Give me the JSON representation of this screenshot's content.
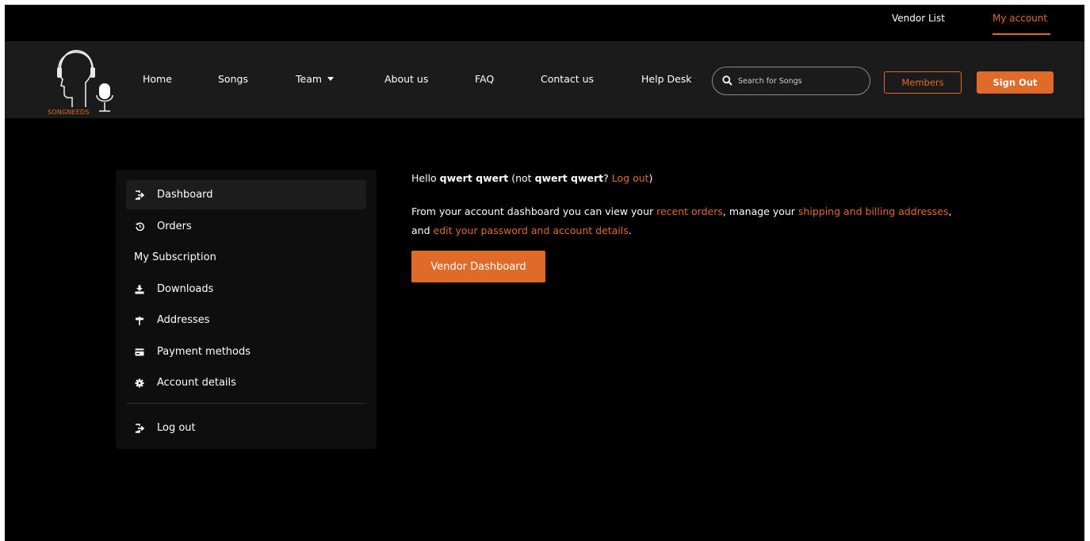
{
  "topbar": {
    "vendor_list": "Vendor List",
    "my_account": "My account"
  },
  "brand": {
    "logo_text": "SONGNEEDS"
  },
  "nav": {
    "home": "Home",
    "songs": "Songs",
    "team": "Team",
    "about": "About us",
    "faq": "FAQ",
    "contact": "Contact us",
    "help": "Help Desk"
  },
  "search": {
    "placeholder": "Search for Songs"
  },
  "buttons": {
    "members": "Members",
    "sign_out": "Sign Out",
    "vendor_dashboard": "Vendor Dashboard"
  },
  "sidebar": {
    "items": [
      {
        "label": "Dashboard",
        "icon": "sign-in-icon"
      },
      {
        "label": "Orders",
        "icon": "history-icon"
      },
      {
        "label": "My Subscription",
        "icon": ""
      },
      {
        "label": "Downloads",
        "icon": "download-icon"
      },
      {
        "label": "Addresses",
        "icon": "signpost-icon"
      },
      {
        "label": "Payment methods",
        "icon": "credit-card-icon"
      },
      {
        "label": "Account details",
        "icon": "gear-icon"
      },
      {
        "label": "Log out",
        "icon": "sign-out-icon"
      }
    ]
  },
  "main": {
    "hello_prefix": "Hello ",
    "username": "qwert qwert",
    "not_prefix": " (not ",
    "username2": "qwert qwert",
    "question": "? ",
    "logout_link": "Log out",
    "close_paren": ")",
    "desc_1": "From your account dashboard you can view your ",
    "recent_orders": "recent orders",
    "desc_2": ", manage your ",
    "shipping_link": "shipping and billing addresses",
    "desc_3": ", and ",
    "edit_link": "edit your password and account details",
    "desc_4": "."
  },
  "colors": {
    "accent": "#e06a28",
    "header_bg": "#1b1b1b",
    "page_bg": "#000000",
    "sidebar_bg": "#0e0e0e"
  }
}
